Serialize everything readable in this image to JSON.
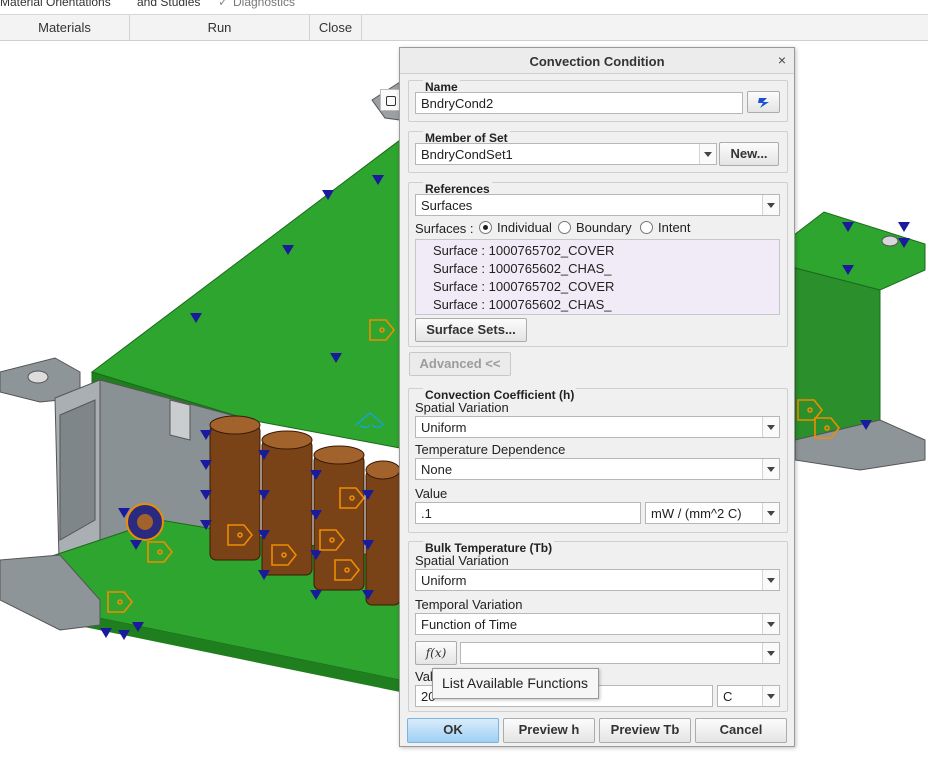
{
  "ribbon": {
    "top_fragments": [
      "Material Orientations",
      "and Studies",
      "Diagnostics"
    ],
    "groups": [
      "Materials",
      "Run",
      "Close"
    ]
  },
  "dialog": {
    "title": "Convection Condition",
    "name": {
      "label": "Name",
      "value": "BndryCond2"
    },
    "member_of_set": {
      "label": "Member of Set",
      "value": "BndryCondSet1",
      "new_button": "New..."
    },
    "references": {
      "label": "References",
      "type": "Surfaces",
      "mode_label": "Surfaces :",
      "options": [
        "Individual",
        "Boundary",
        "Intent"
      ],
      "selected_option": "Individual",
      "items": [
        "Surface : 1000765702_COVER",
        "Surface : 1000765602_CHAS_",
        "Surface : 1000765702_COVER",
        "Surface : 1000765602_CHAS_"
      ],
      "surface_sets_button": "Surface Sets..."
    },
    "advanced_button": "Advanced <<",
    "convection_coefficient": {
      "label": "Convection Coefficient (h)",
      "spatial_label": "Spatial Variation",
      "spatial_value": "Uniform",
      "temperature_label": "Temperature Dependence",
      "temperature_value": "None",
      "value_label": "Value",
      "value": ".1",
      "unit": "mW / (mm^2 C)"
    },
    "bulk_temperature": {
      "label": "Bulk Temperature (Tb)",
      "spatial_label": "Spatial Variation",
      "spatial_value": "Uniform",
      "temporal_label": "Temporal Variation",
      "temporal_value": "Function of Time",
      "fx_button": "f(x)",
      "function_value": "",
      "value_label": "Val",
      "value": "20",
      "unit": "C"
    },
    "buttons": {
      "ok": "OK",
      "preview_h": "Preview h",
      "preview_tb": "Preview Tb",
      "cancel": "Cancel"
    },
    "close_symbol": "×"
  },
  "tooltip": "List Available Functions",
  "colors": {
    "board_green": "#2ea52e",
    "metal_grey": "#9aa0a3",
    "capacitor_brown": "#7a4217",
    "constraint_blue": "#1a1a9c",
    "annotation_orange": "#f08c00",
    "ok_button": "#9fd0f5"
  }
}
